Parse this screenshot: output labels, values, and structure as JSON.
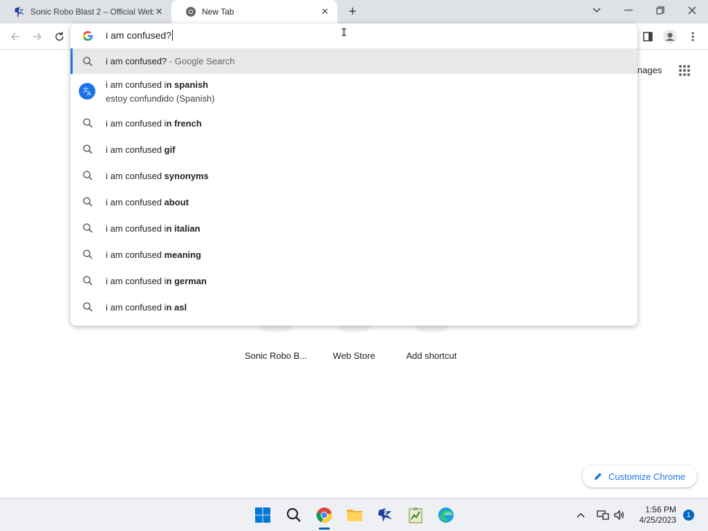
{
  "tabs": [
    {
      "title": "Sonic Robo Blast 2 – Official Web",
      "favicon": "sonic-favicon"
    },
    {
      "title": "New Tab",
      "favicon": "chrome-favicon"
    }
  ],
  "omnibox": {
    "value": "i am confused?",
    "icon": "google-g-icon"
  },
  "suggestions": [
    {
      "icon": "search-icon",
      "text": "i am confused?",
      "bold": "",
      "suffix": " - Google Search",
      "selected": true
    },
    {
      "icon": "translate-icon",
      "text": "i am confused i",
      "bold": "n spanish",
      "subtitle": "estoy confundido (Spanish)"
    },
    {
      "icon": "search-icon",
      "text": "i am confused i",
      "bold": "n french"
    },
    {
      "icon": "search-icon",
      "text": "i am confused ",
      "bold": "gif"
    },
    {
      "icon": "search-icon",
      "text": "i am confused ",
      "bold": "synonyms"
    },
    {
      "icon": "search-icon",
      "text": "i am confused ",
      "bold": "about"
    },
    {
      "icon": "search-icon",
      "text": "i am confused i",
      "bold": "n italian",
      "partial": "n i"
    },
    {
      "icon": "search-icon",
      "text": "i am confused ",
      "bold": "meaning"
    },
    {
      "icon": "search-icon",
      "text": "i am confused i",
      "bold": "n german"
    },
    {
      "icon": "search-icon",
      "text": "i am confused i",
      "bold": "n asl"
    }
  ],
  "page": {
    "images_link": "nages",
    "shortcuts": [
      {
        "label": "Sonic Robo B..."
      },
      {
        "label": "Web Store"
      },
      {
        "label": "Add shortcut"
      }
    ],
    "customize_label": "Customize Chrome"
  },
  "taskbar": {
    "time": "1:56 PM",
    "date": "4/25/2023",
    "notification_count": "1"
  },
  "colors": {
    "accent": "#1a73e8",
    "tabstrip": "#dee1e6",
    "selected_row": "#e8e8e9"
  }
}
